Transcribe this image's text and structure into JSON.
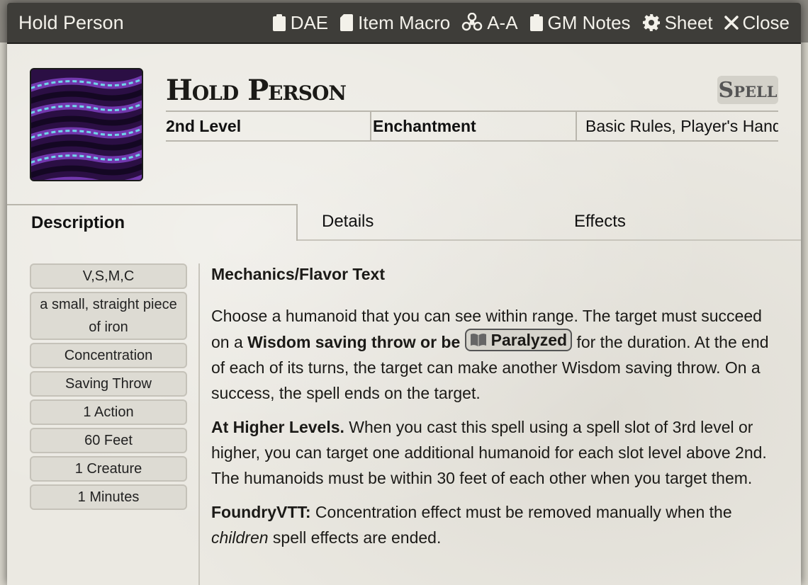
{
  "window": {
    "title": "Hold Person",
    "header_buttons": [
      {
        "label": "DAE",
        "icon": "clipboard-icon"
      },
      {
        "label": "Item Macro",
        "icon": "sd-card-icon"
      },
      {
        "label": "A-A",
        "icon": "biohazard-icon"
      },
      {
        "label": "GM Notes",
        "icon": "clipboard-icon"
      },
      {
        "label": "Sheet",
        "icon": "gear-icon"
      },
      {
        "label": "Close",
        "icon": "close-icon"
      }
    ]
  },
  "item": {
    "name": "Hold Person",
    "type": "Spell",
    "level": "2nd Level",
    "school": "Enchantment",
    "source": "Basic Rules, Player's Handbook"
  },
  "tabs": [
    {
      "label": "Description",
      "active": true
    },
    {
      "label": "Details",
      "active": false
    },
    {
      "label": "Effects",
      "active": false
    }
  ],
  "properties": [
    "V,S,M,C",
    "a small, straight piece of iron",
    "Concentration",
    "Saving Throw",
    "1 Action",
    "60 Feet",
    "1 Creature",
    "1 Minutes"
  ],
  "description": {
    "heading": "Mechanics/Flavor Text",
    "p1_start": "Choose a humanoid that you can see within range. The target must succeed on a ",
    "p1_bold": "Wisdom saving throw or be",
    "p1_condition": "Paralyzed",
    "p1_end": " for the duration. At the end of each of its turns, the target can make another Wisdom saving throw. On a success, the spell ends on the target.",
    "p2_bold": "At Higher Levels.",
    "p2_text": " When you cast this spell using a spell slot of 3rd level or higher, you can target one additional humanoid for each slot level above 2nd. The humanoids must be within 30 feet of each other when you target them.",
    "p3_bold": "FoundryVTT:",
    "p3_text_a": " Concentration effect must be removed manually when the ",
    "p3_italic": "children",
    "p3_text_b": " spell effects are ended."
  },
  "colors": {
    "titlebar": "#3e3d39",
    "sheet_bg": "#ebe9e2",
    "badge_bg": "#d3d1c9"
  }
}
